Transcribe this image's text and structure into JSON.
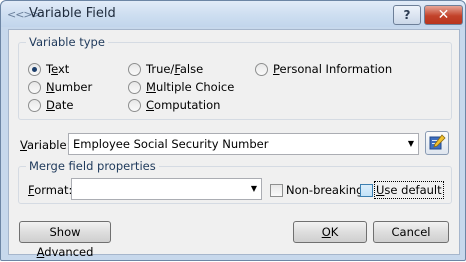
{
  "window": {
    "title": "Variable Field",
    "help_label": "?",
    "close_label": "✕"
  },
  "variable_type": {
    "group_label": "Variable type",
    "options": [
      {
        "pre": "T",
        "key": "e",
        "post": "xt",
        "selected": true
      },
      {
        "pre": "",
        "key": "N",
        "post": "umber",
        "selected": false
      },
      {
        "pre": "",
        "key": "D",
        "post": "ate",
        "selected": false
      },
      {
        "pre": "True/",
        "key": "F",
        "post": "alse",
        "selected": false
      },
      {
        "pre": "",
        "key": "M",
        "post": "ultiple Choice",
        "selected": false
      },
      {
        "pre": "",
        "key": "C",
        "post": "omputation",
        "selected": false
      },
      {
        "pre": "",
        "key": "P",
        "post": "ersonal Information",
        "selected": false
      }
    ]
  },
  "variable": {
    "label_key": "V",
    "label_rest": "ariable:",
    "value": "Employee Social Security Number",
    "edit_icon": "edit-pencil-icon"
  },
  "merge": {
    "group_label": "Merge field properties",
    "format_key": "F",
    "format_rest": "ormat:",
    "format_value": "",
    "nonbreaking_label": "Non-breaking",
    "nonbreaking_checked": false,
    "use_default_key": "U",
    "use_default_rest": "se default",
    "use_default_checked": false
  },
  "buttons": {
    "advanced_pre": "Show ",
    "advanced_key": "A",
    "advanced_post": "dvanced",
    "ok_key": "O",
    "ok_rest": "K",
    "cancel": "Cancel"
  }
}
